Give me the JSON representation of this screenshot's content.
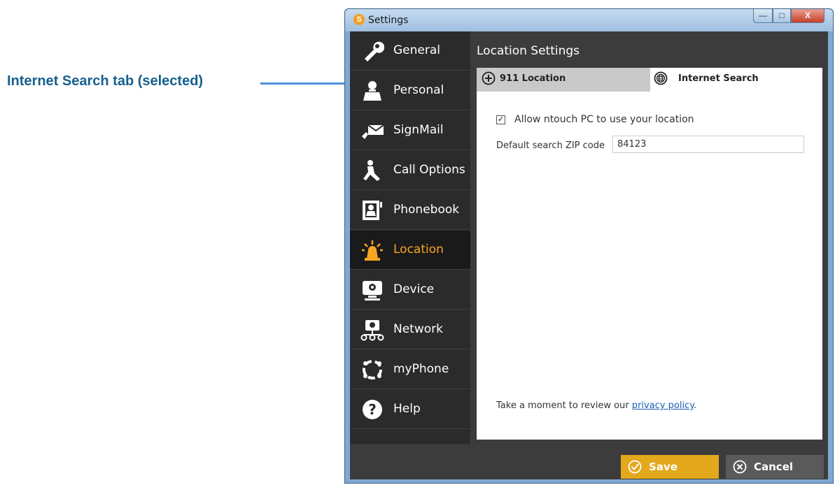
{
  "annotation": {
    "label": "Internet Search tab (selected)",
    "color": "#17608f",
    "arrow_color": "#4a90d9"
  },
  "window": {
    "title": "Settings",
    "controls": {
      "minimize": "—",
      "maximize": "□",
      "close": "X"
    }
  },
  "sidebar": {
    "items": [
      {
        "label": "General",
        "icon": "wrench-icon"
      },
      {
        "label": "Personal",
        "icon": "person-icon"
      },
      {
        "label": "SignMail",
        "icon": "signmail-icon"
      },
      {
        "label": "Call Options",
        "icon": "call-options-icon"
      },
      {
        "label": "Phonebook",
        "icon": "phonebook-icon"
      },
      {
        "label": "Location",
        "icon": "beacon-icon",
        "selected": true
      },
      {
        "label": "Device",
        "icon": "webcam-icon"
      },
      {
        "label": "Network",
        "icon": "network-icon"
      },
      {
        "label": "myPhone",
        "icon": "myphone-icon"
      },
      {
        "label": "Help",
        "icon": "help-icon"
      }
    ]
  },
  "main": {
    "title": "Location Settings",
    "tabs": [
      {
        "label": "911 Location",
        "icon": "plus-circle-icon"
      },
      {
        "label": "Internet Search",
        "icon": "globe-icon",
        "selected": true
      }
    ],
    "allow_location": {
      "label": "Allow ntouch PC to use your location",
      "checked": true
    },
    "zip": {
      "label": "Default search ZIP code",
      "value": "84123"
    },
    "privacy": {
      "prefix": "Take a moment to review our ",
      "link": "privacy policy",
      "suffix": "."
    }
  },
  "footer": {
    "save_label": "Save",
    "cancel_label": "Cancel"
  },
  "colors": {
    "accent": "#f5a623",
    "save": "#e3a81b",
    "sidebar_bg": "#2b2b2b",
    "selected_bg": "#1a1a1a"
  }
}
